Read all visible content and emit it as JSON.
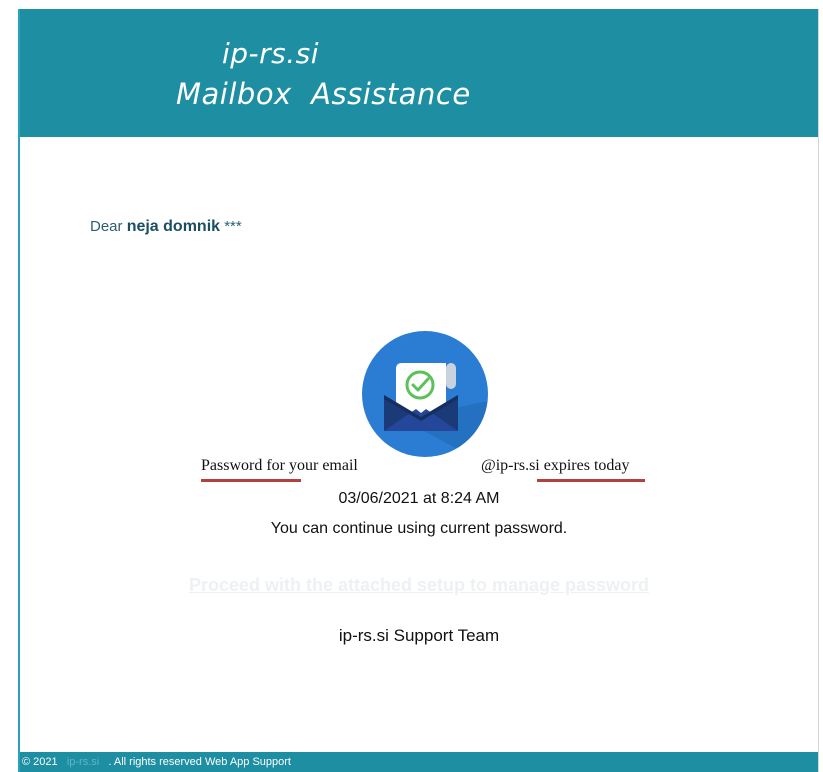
{
  "header": {
    "site": "ip-rs.si",
    "title": "Mailbox  Assistance"
  },
  "greeting": {
    "prefix": "Dear",
    "name": "neja domnik",
    "suffix": "***"
  },
  "logo": {
    "icon": "envelope-check-icon",
    "colors": {
      "circle": "#2b7dd3",
      "envelope": "#1b3a78",
      "check": "#5cc15a"
    }
  },
  "message": {
    "line_part1": "Password for your email",
    "line_part2": "@ip-rs.si expires today",
    "date": "03/06/2021 at 8:24 AM",
    "continue": "You can continue using current password."
  },
  "link": {
    "text": "Proceed with the attached setup to manage password"
  },
  "signature": "ip-rs.si Support Team",
  "footer": {
    "copyright": "© 2021",
    "site": "ip-rs.si",
    "text": ". All rights reserved Web App Support"
  },
  "colors": {
    "brand": "#1e8ea3",
    "underline": "#b0413e"
  }
}
